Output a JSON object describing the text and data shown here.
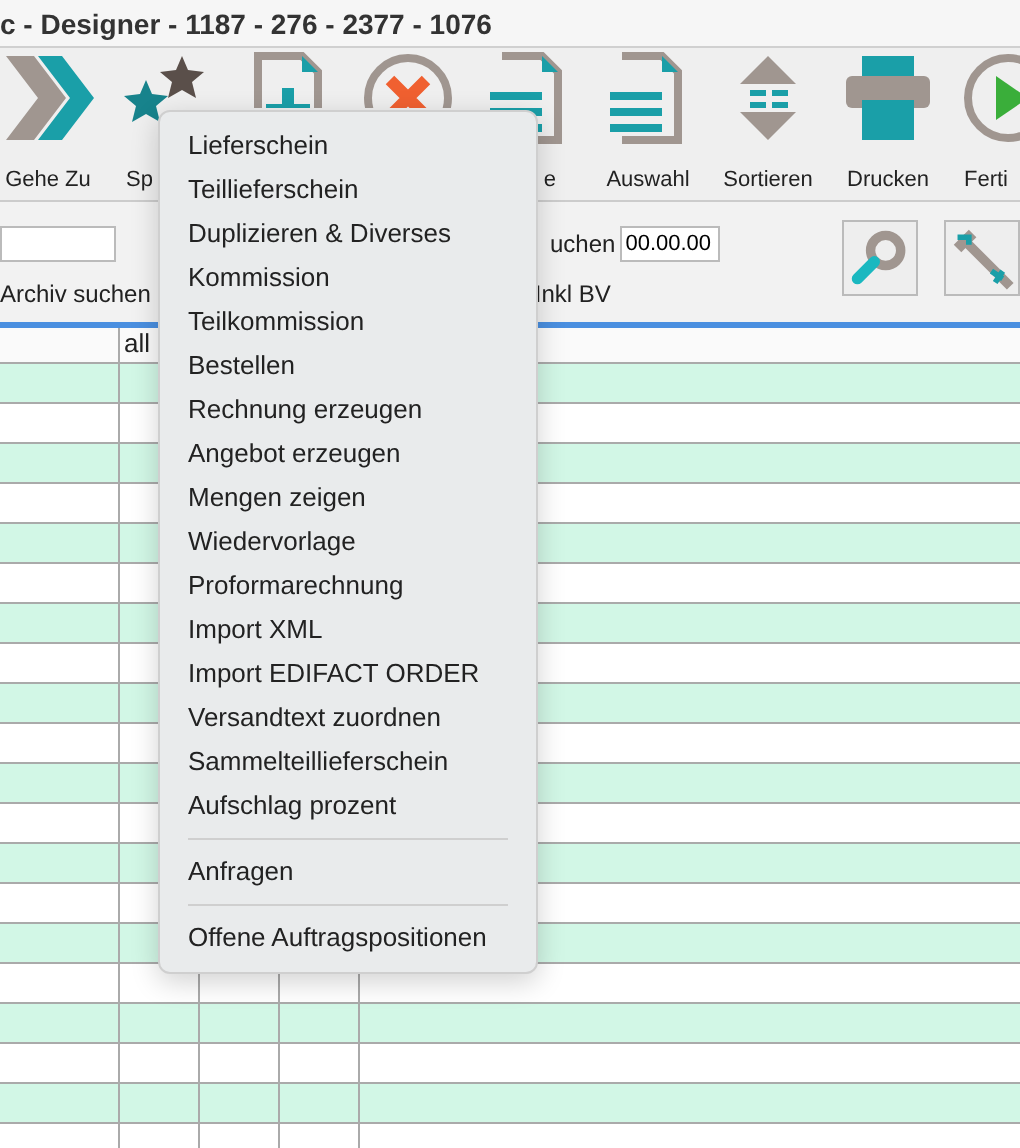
{
  "window": {
    "title": "c - Designer - 1187 - 276 - 2377 - 1076"
  },
  "toolbar": [
    {
      "label": "Gehe Zu",
      "kind": "goto"
    },
    {
      "label": "Sp",
      "kind": "stars"
    },
    {
      "kind": "docplus"
    },
    {
      "kind": "cancel"
    },
    {
      "label": "e",
      "kind": "doclines"
    },
    {
      "label": "Auswahl",
      "kind": "select"
    },
    {
      "label": "Sortieren",
      "kind": "sort"
    },
    {
      "label": "Drucken",
      "kind": "print"
    },
    {
      "label": "Ferti",
      "kind": "play"
    }
  ],
  "filters": {
    "archive_label": "Archiv suchen",
    "date_label": "uchen",
    "date_field": {
      "value": "00.00.00"
    },
    "inkl_label": "Inkl BV"
  },
  "table": {
    "column_2": "all"
  },
  "context_menu": [
    {
      "kind": "item",
      "label": "Lieferschein"
    },
    {
      "kind": "item",
      "label": "Teillieferschein"
    },
    {
      "kind": "item",
      "label": "Duplizieren & Diverses"
    },
    {
      "kind": "item",
      "label": "Kommission"
    },
    {
      "kind": "item",
      "label": "Teilkommission"
    },
    {
      "kind": "item",
      "label": "Bestellen"
    },
    {
      "kind": "item",
      "label": "Rechnung erzeugen"
    },
    {
      "kind": "item",
      "label": "Angebot erzeugen"
    },
    {
      "kind": "item",
      "label": "Mengen zeigen"
    },
    {
      "kind": "item",
      "label": "Wiedervorlage"
    },
    {
      "kind": "item",
      "label": "Proformarechnung"
    },
    {
      "kind": "item",
      "label": "Import XML"
    },
    {
      "kind": "item",
      "label": "Import EDIFACT ORDER"
    },
    {
      "kind": "item",
      "label": "Versandtext zuordnen"
    },
    {
      "kind": "item",
      "label": "Sammelteillieferschein"
    },
    {
      "kind": "item",
      "label": "Aufschlag prozent"
    },
    {
      "kind": "separator"
    },
    {
      "kind": "item",
      "label": "Anfragen"
    },
    {
      "kind": "separator"
    },
    {
      "kind": "item",
      "label": "Offene Auftragspositionen"
    }
  ]
}
